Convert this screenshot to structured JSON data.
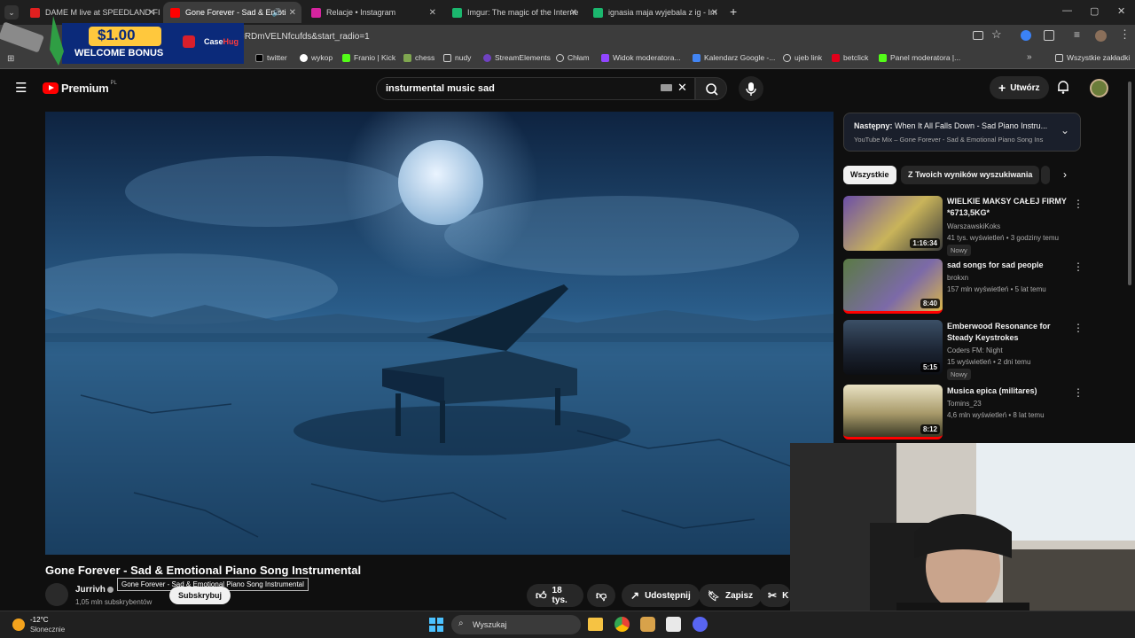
{
  "browser": {
    "tabs": [
      {
        "label": "DAME M live at SPEEDLAND FI",
        "color": "#e02020"
      },
      {
        "label": "Gone Forever - Sad & Emoti",
        "color": "#ff0000"
      },
      {
        "label": "Relacje • Instagram",
        "color": "#d6249f"
      },
      {
        "label": "Imgur: The magic of the Interne",
        "color": "#1bb76e"
      },
      {
        "label": "ignasia maja wyjebala z ig - Im",
        "color": "#1bb76e"
      }
    ],
    "new_tab": "+",
    "url": "=RDmVELNfcufds&start_radio=1",
    "bookmarks": [
      {
        "label": "twitter"
      },
      {
        "label": "wykop"
      },
      {
        "label": "Franio | Kick"
      },
      {
        "label": "chess"
      },
      {
        "label": "nudy"
      },
      {
        "label": "StreamElements"
      },
      {
        "label": "Chłam"
      },
      {
        "label": "Widok moderatora..."
      },
      {
        "label": "Kalendarz Google -..."
      },
      {
        "label": "ujeb link"
      },
      {
        "label": "betclick"
      },
      {
        "label": "Panel moderatora |..."
      }
    ],
    "all_bookmarks": "Wszystkie zakładki"
  },
  "ad": {
    "amount": "$1.00",
    "bonus": "WELCOME BONUS",
    "brand_a": "Case",
    "brand_b": "Hug"
  },
  "youtube": {
    "logo": "Premium",
    "region": "PL",
    "search_value": "insturmental music sad",
    "create_label": "Utwórz"
  },
  "video": {
    "title": "Gone Forever - Sad & Emotional Piano Song Instrumental",
    "tooltip": "Gone Forever - Sad & Emotional Piano Song Instrumental",
    "channel": "Jurrivh",
    "subscribers": "1,05 mln subskrybentów",
    "subscribe": "Subskrybuj",
    "likes": "18 tys.",
    "share": "Udostępnij",
    "save": "Zapisz",
    "clip": "K"
  },
  "up_next": {
    "label": "Następny:",
    "title": "When It All Falls Down - Sad Piano Instru...",
    "sub": "YouTube Mix – Gone Forever - Sad & Emotional Piano Song Ins"
  },
  "chips": [
    "Wszystkie",
    "Z Twoich wyników wyszukiwania"
  ],
  "recommendations": [
    {
      "title": "WIELKIE MAKSY CAŁEJ FIRMY *6713,5KG*",
      "channel": "WarszawskiKoks",
      "meta": "41 tys. wyświetleń • 3 godziny temu",
      "badge": "Nowy",
      "duration": "1:16:34"
    },
    {
      "title": "sad songs for sad people",
      "channel": "brokxn",
      "meta": "157 mln wyświetleń • 5 lat temu",
      "badge": "",
      "duration": "8:40"
    },
    {
      "title": "Emberwood Resonance for Steady Keystrokes",
      "channel": "Coders FM: Night",
      "meta": "15 wyświetleń • 2 dni temu",
      "badge": "Nowy",
      "duration": "5:15"
    },
    {
      "title": "Musica epica (militares)",
      "channel": "Tomins_23",
      "meta": "4,6 mln wyświetleń • 8 lat temu",
      "badge": "",
      "duration": "8:12"
    }
  ],
  "taskbar": {
    "temp": "-12°C",
    "weather": "Słonecznie",
    "search": "Wyszukaj"
  }
}
